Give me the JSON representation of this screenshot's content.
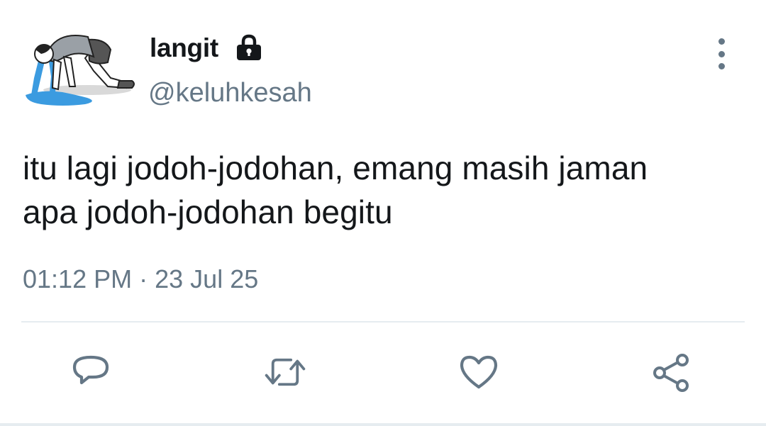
{
  "user": {
    "display_name": "langit",
    "handle": "@keluhkesah",
    "avatar": "avatar-image",
    "lock_icon": "lock-icon"
  },
  "tweet": {
    "text_lines": [
      "itu lagi jodoh-jodohan, emang masih jaman",
      "apa jodoh-jodohan begitu"
    ],
    "time": "01:12 PM",
    "separator": "·",
    "date": "23 Jul 25"
  },
  "actions": [
    {
      "icon": "reply-icon"
    },
    {
      "icon": "retweet-icon"
    },
    {
      "icon": "like-icon"
    },
    {
      "icon": "share-icon"
    }
  ],
  "menu_icon": "more-vertical-icon",
  "colors": {
    "text_primary": "#14171a",
    "text_secondary": "#657786",
    "divider": "#e6ecf0",
    "avatar_tears": "#3b9be0"
  }
}
